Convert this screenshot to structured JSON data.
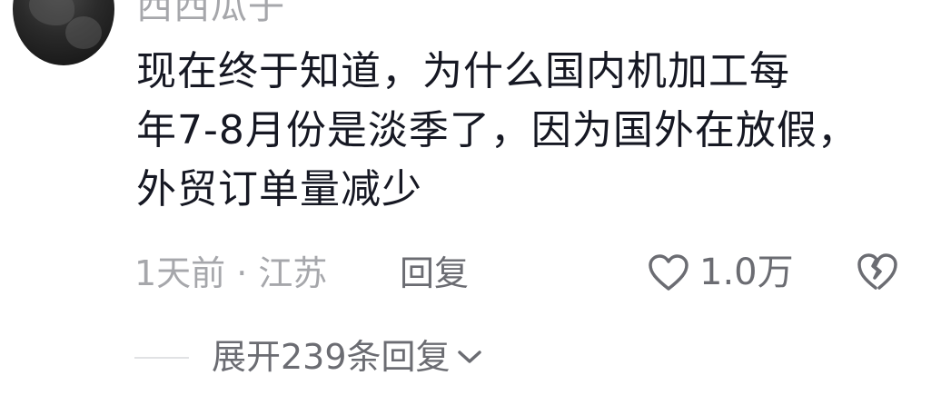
{
  "comment": {
    "username": "西西瓜子",
    "text_lines": [
      "现在终于知道，为什么国内机加工每",
      "年7-8月份是淡季了，因为国外在放假，",
      "外贸订单量减少"
    ],
    "time_location": "1天前 · 江苏",
    "reply_label": "回复",
    "like_count": "1.0万",
    "expand_replies_label": "展开239条回复"
  },
  "icons": {
    "like": "heart-outline-icon",
    "dislike": "broken-heart-icon",
    "expand": "chevron-down-icon"
  },
  "colors": {
    "primary_text": "#161823",
    "secondary_text": "#a6a7ab",
    "action_text": "#6b6c72"
  }
}
